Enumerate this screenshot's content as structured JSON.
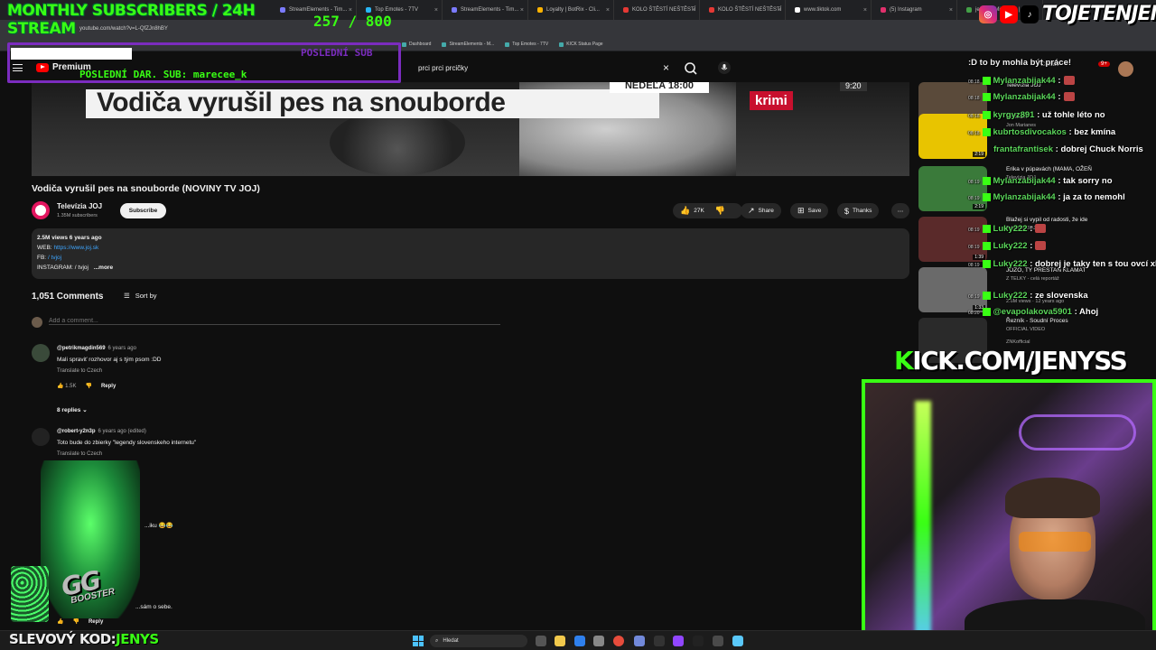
{
  "browser": {
    "tabs": [
      {
        "label": "StreamElements - Tim...",
        "color": "#7b7bff"
      },
      {
        "label": "Top Emotes - 7TV",
        "color": "#29b6f6"
      },
      {
        "label": "StreamElements - Tim...",
        "color": "#7b7bff"
      },
      {
        "label": "Loyalty | BotRix - Cli...",
        "color": "#ffb300"
      },
      {
        "label": "KOLO ŠTĚSTÍ NEŠTĚSTÍ",
        "color": "#e53935"
      },
      {
        "label": "KOLO ŠTĚSTÍ NEŠTĚSTÍ",
        "color": "#e53935"
      },
      {
        "label": "www.tiktok.com",
        "color": "#ffffff"
      },
      {
        "label": "(5) Instagram",
        "color": "#e1306c"
      },
      {
        "label": "jenduj - Minecraft | Hr...",
        "color": "#43a047"
      }
    ],
    "url": "youtube.com/watch?v=L-QfZJn8hBY",
    "bookmarks": [
      {
        "label": "Dashboard"
      },
      {
        "label": "StreamElements - M..."
      },
      {
        "label": "Top Emotes - 7TV"
      },
      {
        "label": "KICK Status Page"
      }
    ]
  },
  "youtube": {
    "logo_label": "Premium",
    "search_value": "prci prci prcičky",
    "video": {
      "caption": "Vodiča vyrušil pes na snouborde",
      "time_banner": "NEDEĽA 18:00",
      "krimi": "krimi",
      "clock": "9:20",
      "title": "Vodiča vyrušil pes na snouborde (NOVINY TV JOJ)"
    },
    "channel": {
      "name": "Televízia JOJ",
      "subs": "1.35M subscribers",
      "subscribe_label": "Subscribe"
    },
    "actions": {
      "likes": "27K",
      "share": "Share",
      "save": "Save",
      "thanks": "Thanks"
    },
    "description": {
      "stats": "2.5M views  6 years ago",
      "web_label": "WEB:",
      "web_link": "https://www.joj.sk",
      "fb_label": "FB:",
      "fb_value": "/ tvjoj",
      "ig_label": "INSTAGRAM:",
      "ig_value": "/ tvjoj",
      "more": "...more"
    },
    "comments": {
      "count": "1,051 Comments",
      "sort_label": "Sort by",
      "add_placeholder": "Add a comment...",
      "items": [
        {
          "author": "@petrikmagdin569",
          "ago": "6 years ago",
          "text": "Mali spraviť rozhovor aj s tým psom :DD",
          "translate": "Translate to Czech",
          "likes": "1.5K",
          "reply": "Reply",
          "replies": "8 replies"
        },
        {
          "author": "@robert-y2n3p",
          "ago": "6 years ago (edited)",
          "text": "Toto bude do zbierky \"legendy slovenskeho internetu\"",
          "translate": "Translate to Czech"
        }
      ],
      "partial_1": "...iku 😂😂",
      "partial_2": "...sám o sebe.",
      "partial_reply": "Reply"
    },
    "create_label": "Create",
    "notif_count": "9+",
    "chat_overlay_top": ":D to by mohla být práce!"
  },
  "related": [
    {
      "title": "Televízia JOJ",
      "sub": "",
      "dur": "0:52"
    },
    {
      "title": "ČRIEE!!",
      "sub": "Jon Marianes",
      "dur": "2:19"
    },
    {
      "title": "Erika v púpavách (MAMA, OŽEŇ",
      "sub": "Televízia JOJ",
      "dur": "2:19"
    },
    {
      "title": "Blažej si vypil od radosti, že ide",
      "sub": "Televízia JOJ",
      "dur": "1:39"
    },
    {
      "title": "JOZO, TY PRESTAN KLAMAT",
      "sub": "Z TELKY - celá reportáž",
      "dur": "1:33"
    },
    {
      "title": "Řezník - Soudní Proces",
      "sub": "OFFICIAL VIDEO",
      "dur": ""
    }
  ],
  "related_extra": {
    "views_1": "2.6M views · 12 years ago",
    "channel_6": "ZNKofficial"
  },
  "chat": [
    {
      "time": "08:18",
      "user": "Mylanzabijak44",
      "msg": ":",
      "emote": true
    },
    {
      "time": "08:18",
      "user": "Mylanzabijak44",
      "msg": ":",
      "emote": true
    },
    {
      "time": "08:18",
      "user": "kyrgyz891",
      "msg": ": už tohle léto no",
      "emote": false
    },
    {
      "time": "08:18",
      "user": "kubrtosdivocakos",
      "msg": ": bez kmína",
      "emote": false
    },
    {
      "time": "",
      "user": "frantafrantisek",
      "msg": ": dobrej Chuck Norris",
      "emote": false
    },
    {
      "time": "08:19",
      "user": "Mylanzabijak44",
      "msg": ": tak sorry no",
      "emote": false
    },
    {
      "time": "08:19",
      "user": "Mylanzabijak44",
      "msg": ": ja za to nemohl",
      "emote": false
    },
    {
      "time": "08:19",
      "user": "Luky222",
      "msg": ":",
      "emote": true
    },
    {
      "time": "08:19",
      "user": "Luky222",
      "msg": ":",
      "emote": true
    },
    {
      "time": "08:19",
      "user": "Luky222",
      "msg": ": dobrej je taky ten s tou ovcí xD",
      "emote": false
    },
    {
      "time": "08:19",
      "user": "Luky222",
      "msg": ": ze slovenska",
      "emote": false
    },
    {
      "time": "08:20",
      "user": "@evapolakova5901",
      "msg": ": Ahoj",
      "emote": false
    }
  ],
  "overlay": {
    "title": "MONTHLY SUBSCRIBERS / 24H STREAM",
    "progress": "257 / 800",
    "last_sub_label": "POSLEDNÍ SUB",
    "last_donation": "POSLEDNÍ DAR. SUB: marecee_k",
    "handle": "TOJETENJENYS",
    "kick_prefix": "K",
    "kick_url": "ICK.COM/JENYSS",
    "promo_label": "SLEVOVÝ KOD:",
    "promo_code": "JENYS",
    "booster_text": "GG",
    "booster_sub": "BOOSTER",
    "accent": "#39ff14",
    "purple": "#7b2cbf"
  },
  "taskbar": {
    "search_placeholder": "Hledat"
  }
}
